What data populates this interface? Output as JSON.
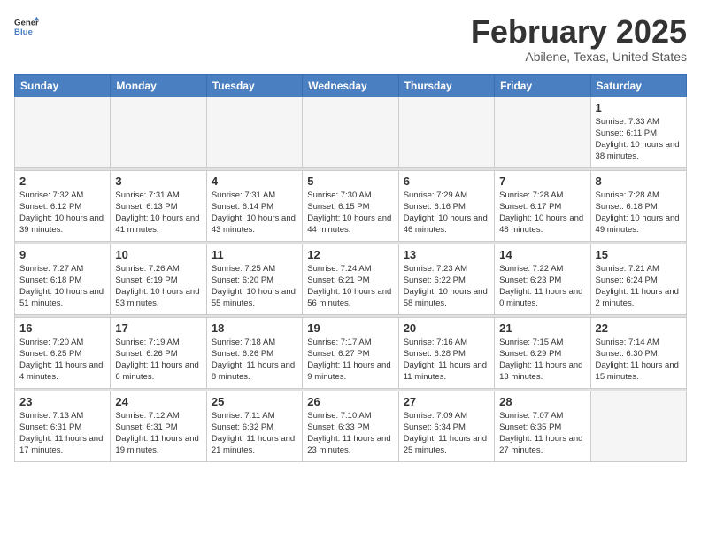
{
  "header": {
    "logo_general": "General",
    "logo_blue": "Blue",
    "month": "February 2025",
    "location": "Abilene, Texas, United States"
  },
  "days_of_week": [
    "Sunday",
    "Monday",
    "Tuesday",
    "Wednesday",
    "Thursday",
    "Friday",
    "Saturday"
  ],
  "weeks": [
    [
      {
        "day": "",
        "empty": true
      },
      {
        "day": "",
        "empty": true
      },
      {
        "day": "",
        "empty": true
      },
      {
        "day": "",
        "empty": true
      },
      {
        "day": "",
        "empty": true
      },
      {
        "day": "",
        "empty": true
      },
      {
        "day": "1",
        "sunrise": "Sunrise: 7:33 AM",
        "sunset": "Sunset: 6:11 PM",
        "daylight": "Daylight: 10 hours and 38 minutes."
      }
    ],
    [
      {
        "day": "2",
        "sunrise": "Sunrise: 7:32 AM",
        "sunset": "Sunset: 6:12 PM",
        "daylight": "Daylight: 10 hours and 39 minutes."
      },
      {
        "day": "3",
        "sunrise": "Sunrise: 7:31 AM",
        "sunset": "Sunset: 6:13 PM",
        "daylight": "Daylight: 10 hours and 41 minutes."
      },
      {
        "day": "4",
        "sunrise": "Sunrise: 7:31 AM",
        "sunset": "Sunset: 6:14 PM",
        "daylight": "Daylight: 10 hours and 43 minutes."
      },
      {
        "day": "5",
        "sunrise": "Sunrise: 7:30 AM",
        "sunset": "Sunset: 6:15 PM",
        "daylight": "Daylight: 10 hours and 44 minutes."
      },
      {
        "day": "6",
        "sunrise": "Sunrise: 7:29 AM",
        "sunset": "Sunset: 6:16 PM",
        "daylight": "Daylight: 10 hours and 46 minutes."
      },
      {
        "day": "7",
        "sunrise": "Sunrise: 7:28 AM",
        "sunset": "Sunset: 6:17 PM",
        "daylight": "Daylight: 10 hours and 48 minutes."
      },
      {
        "day": "8",
        "sunrise": "Sunrise: 7:28 AM",
        "sunset": "Sunset: 6:18 PM",
        "daylight": "Daylight: 10 hours and 49 minutes."
      }
    ],
    [
      {
        "day": "9",
        "sunrise": "Sunrise: 7:27 AM",
        "sunset": "Sunset: 6:18 PM",
        "daylight": "Daylight: 10 hours and 51 minutes."
      },
      {
        "day": "10",
        "sunrise": "Sunrise: 7:26 AM",
        "sunset": "Sunset: 6:19 PM",
        "daylight": "Daylight: 10 hours and 53 minutes."
      },
      {
        "day": "11",
        "sunrise": "Sunrise: 7:25 AM",
        "sunset": "Sunset: 6:20 PM",
        "daylight": "Daylight: 10 hours and 55 minutes."
      },
      {
        "day": "12",
        "sunrise": "Sunrise: 7:24 AM",
        "sunset": "Sunset: 6:21 PM",
        "daylight": "Daylight: 10 hours and 56 minutes."
      },
      {
        "day": "13",
        "sunrise": "Sunrise: 7:23 AM",
        "sunset": "Sunset: 6:22 PM",
        "daylight": "Daylight: 10 hours and 58 minutes."
      },
      {
        "day": "14",
        "sunrise": "Sunrise: 7:22 AM",
        "sunset": "Sunset: 6:23 PM",
        "daylight": "Daylight: 11 hours and 0 minutes."
      },
      {
        "day": "15",
        "sunrise": "Sunrise: 7:21 AM",
        "sunset": "Sunset: 6:24 PM",
        "daylight": "Daylight: 11 hours and 2 minutes."
      }
    ],
    [
      {
        "day": "16",
        "sunrise": "Sunrise: 7:20 AM",
        "sunset": "Sunset: 6:25 PM",
        "daylight": "Daylight: 11 hours and 4 minutes."
      },
      {
        "day": "17",
        "sunrise": "Sunrise: 7:19 AM",
        "sunset": "Sunset: 6:26 PM",
        "daylight": "Daylight: 11 hours and 6 minutes."
      },
      {
        "day": "18",
        "sunrise": "Sunrise: 7:18 AM",
        "sunset": "Sunset: 6:26 PM",
        "daylight": "Daylight: 11 hours and 8 minutes."
      },
      {
        "day": "19",
        "sunrise": "Sunrise: 7:17 AM",
        "sunset": "Sunset: 6:27 PM",
        "daylight": "Daylight: 11 hours and 9 minutes."
      },
      {
        "day": "20",
        "sunrise": "Sunrise: 7:16 AM",
        "sunset": "Sunset: 6:28 PM",
        "daylight": "Daylight: 11 hours and 11 minutes."
      },
      {
        "day": "21",
        "sunrise": "Sunrise: 7:15 AM",
        "sunset": "Sunset: 6:29 PM",
        "daylight": "Daylight: 11 hours and 13 minutes."
      },
      {
        "day": "22",
        "sunrise": "Sunrise: 7:14 AM",
        "sunset": "Sunset: 6:30 PM",
        "daylight": "Daylight: 11 hours and 15 minutes."
      }
    ],
    [
      {
        "day": "23",
        "sunrise": "Sunrise: 7:13 AM",
        "sunset": "Sunset: 6:31 PM",
        "daylight": "Daylight: 11 hours and 17 minutes."
      },
      {
        "day": "24",
        "sunrise": "Sunrise: 7:12 AM",
        "sunset": "Sunset: 6:31 PM",
        "daylight": "Daylight: 11 hours and 19 minutes."
      },
      {
        "day": "25",
        "sunrise": "Sunrise: 7:11 AM",
        "sunset": "Sunset: 6:32 PM",
        "daylight": "Daylight: 11 hours and 21 minutes."
      },
      {
        "day": "26",
        "sunrise": "Sunrise: 7:10 AM",
        "sunset": "Sunset: 6:33 PM",
        "daylight": "Daylight: 11 hours and 23 minutes."
      },
      {
        "day": "27",
        "sunrise": "Sunrise: 7:09 AM",
        "sunset": "Sunset: 6:34 PM",
        "daylight": "Daylight: 11 hours and 25 minutes."
      },
      {
        "day": "28",
        "sunrise": "Sunrise: 7:07 AM",
        "sunset": "Sunset: 6:35 PM",
        "daylight": "Daylight: 11 hours and 27 minutes."
      },
      {
        "day": "",
        "empty": true
      }
    ]
  ]
}
